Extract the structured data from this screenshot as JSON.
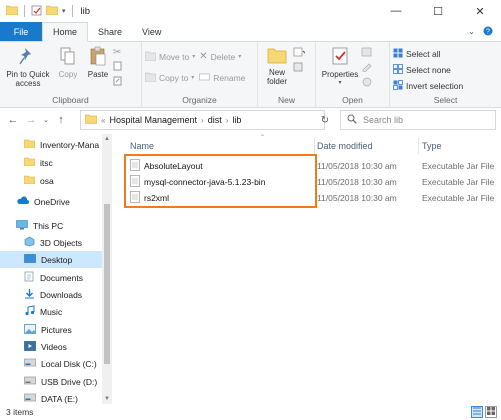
{
  "window": {
    "title": "lib",
    "minimize": "—",
    "maximize": "☐",
    "close": "✕"
  },
  "tabs": [
    {
      "label": "File"
    },
    {
      "label": "Home"
    },
    {
      "label": "Share"
    },
    {
      "label": "View"
    }
  ],
  "ribbon": {
    "clipboard": {
      "label": "Clipboard",
      "pin": "Pin to Quick access",
      "copy": "Copy",
      "paste": "Paste"
    },
    "organize": {
      "label": "Organize",
      "move_to": "Move to",
      "copy_to": "Copy to",
      "delete": "Delete",
      "rename": "Rename"
    },
    "new": {
      "label": "New",
      "new_folder": "New folder"
    },
    "open": {
      "label": "Open",
      "properties": "Properties"
    },
    "select": {
      "label": "Select",
      "select_all": "Select all",
      "select_none": "Select none",
      "invert": "Invert selection"
    }
  },
  "address": {
    "prefix": "«",
    "segments": [
      "Hospital Management",
      "dist",
      "lib"
    ],
    "search_placeholder": "Search lib"
  },
  "nav": {
    "items": [
      {
        "label": "Inventory-Mana",
        "icon": "folder-icon"
      },
      {
        "label": "itsc",
        "icon": "folder-icon"
      },
      {
        "label": "osa",
        "icon": "folder-icon"
      },
      {
        "label": "OneDrive",
        "icon": "cloud-icon"
      },
      {
        "label": "This PC",
        "icon": "computer-icon"
      },
      {
        "label": "3D Objects",
        "icon": "cube-icon"
      },
      {
        "label": "Desktop",
        "icon": "desktop-icon"
      },
      {
        "label": "Documents",
        "icon": "documents-icon"
      },
      {
        "label": "Downloads",
        "icon": "download-icon"
      },
      {
        "label": "Music",
        "icon": "music-icon"
      },
      {
        "label": "Pictures",
        "icon": "pictures-icon"
      },
      {
        "label": "Videos",
        "icon": "videos-icon"
      },
      {
        "label": "Local Disk (C:)",
        "icon": "drive-icon"
      },
      {
        "label": "USB Drive (D:)",
        "icon": "usb-drive-icon"
      },
      {
        "label": "DATA (E:)",
        "icon": "drive-icon"
      }
    ]
  },
  "columns": {
    "name": "Name",
    "date": "Date modified",
    "type": "Type"
  },
  "files": [
    {
      "name": "AbsoluteLayout",
      "date": "11/05/2018 10:30 am",
      "type": "Executable Jar File"
    },
    {
      "name": "mysql-connector-java-5.1.23-bin",
      "date": "11/05/2018 10:30 am",
      "type": "Executable Jar File"
    },
    {
      "name": "rs2xml",
      "date": "11/05/2018 10:30 am",
      "type": "Executable Jar File"
    }
  ],
  "status": {
    "count": "3 items"
  },
  "colors": {
    "accent": "#1979ca",
    "highlight_box": "#f07c1c",
    "selected": "#cce8ff",
    "folder": "#f8d775"
  }
}
